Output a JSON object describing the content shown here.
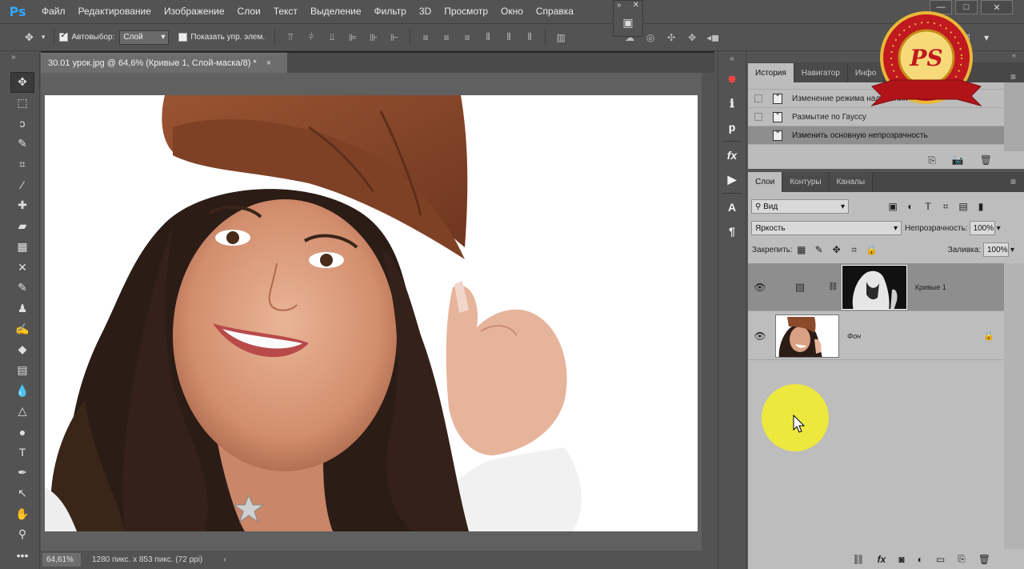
{
  "app": {
    "logo": "Ps"
  },
  "menu": [
    "Файл",
    "Редактирование",
    "Изображение",
    "Слои",
    "Текст",
    "Выделение",
    "Фильтр",
    "3D",
    "Просмотр",
    "Окно",
    "Справка"
  ],
  "window_controls": {
    "minimize": "—",
    "maximize": "□",
    "close": "✕"
  },
  "options": {
    "autoselect_label": "Автовыбор:",
    "autoselect_checked": true,
    "autoselect_value": "Слой",
    "show_transform_label": "Показать упр. элем.",
    "show_transform_checked": false
  },
  "document": {
    "tab_title": "30.01 урок.jpg @ 64,6% (Кривые 1, Слой-маска/8) *",
    "tab_close": "×",
    "zoom": "64,61%",
    "info": "1280 пикс. x 853 пикс. (72 ppi)",
    "info_arrow": "›"
  },
  "history_panel": {
    "tabs": [
      "История",
      "Навигатор",
      "Инфо"
    ],
    "active_tab": "История",
    "items": [
      {
        "label": "Изменение режима наложения",
        "selected": false
      },
      {
        "label": "Размытие по Гауссу",
        "selected": false
      },
      {
        "label": "Изменить основную непрозрачность",
        "selected": true
      }
    ]
  },
  "layers_panel": {
    "tabs": [
      "Слои",
      "Контуры",
      "Каналы"
    ],
    "active_tab": "Слои",
    "filter_value": "Вид",
    "blend_mode": "Яркость",
    "opacity_label": "Непрозрачность:",
    "opacity_value": "100%",
    "lock_label": "Закрепить:",
    "fill_label": "Заливка:",
    "fill_value": "100%",
    "layers": [
      {
        "name": "Кривые 1",
        "selected": true,
        "visible": true,
        "locked": false
      },
      {
        "name": "Фон",
        "selected": false,
        "visible": true,
        "locked": true
      }
    ]
  },
  "badge": {
    "text": "PS"
  },
  "colors": {
    "ui_dark": "#535353",
    "panel_light": "#bdbdbd",
    "selection": "#8e8e8e",
    "ps_blue": "#31a8ff",
    "badge_red": "#c0191f",
    "badge_gold": "#e8b838",
    "cursor_highlight": "#f5f028",
    "hat_brown": "#8b4a2a"
  }
}
